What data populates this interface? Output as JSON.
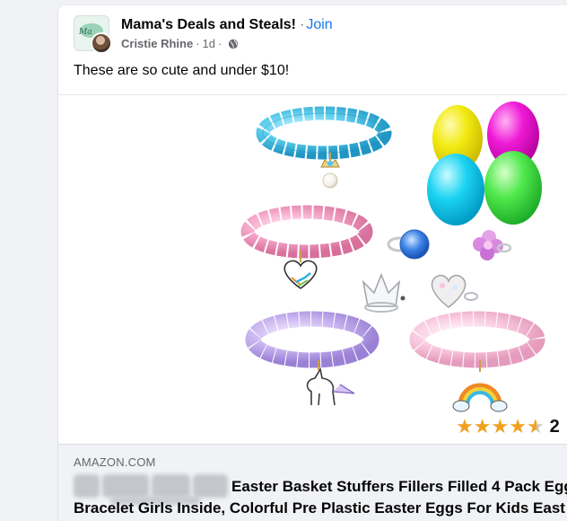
{
  "post": {
    "group_name": "Mama's Deals and Steals!",
    "separator": "·",
    "join_label": "Join",
    "author": "Cristie Rhine",
    "meta_separator": "·",
    "time_ago": "1d",
    "audience_icon": "globe-icon",
    "text": "These are so cute and under $10!"
  },
  "product_image": {
    "rating_stars": 4.5,
    "rating_count": "2"
  },
  "link_preview": {
    "domain": "AMAZON.COM",
    "title_line_1": "Easter Basket Stuffers Fillers Filled 4 Pack Egg",
    "title_line_2": "Bracelet Girls Inside, Colorful Pre Plastic Easter Eggs For Kids East"
  },
  "colors": {
    "link_blue": "#1877f2",
    "secondary_text": "#65676b",
    "star_orange": "#f0a21f"
  }
}
